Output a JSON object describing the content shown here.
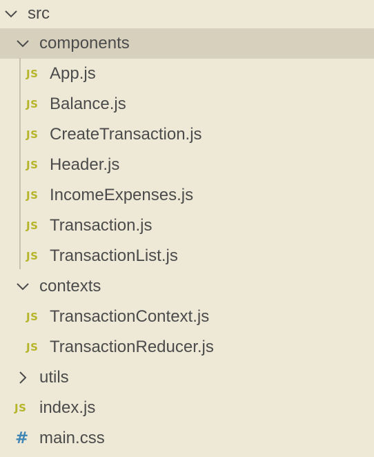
{
  "explorer": {
    "src": {
      "label": "src",
      "expanded": true,
      "chevron": "chevron-down-icon"
    },
    "components": {
      "label": "components",
      "expanded": true,
      "chevron": "chevron-down-icon",
      "files": [
        {
          "icon_text": "JS",
          "label": "App.js"
        },
        {
          "icon_text": "JS",
          "label": "Balance.js"
        },
        {
          "icon_text": "JS",
          "label": "CreateTransaction.js"
        },
        {
          "icon_text": "JS",
          "label": "Header.js"
        },
        {
          "icon_text": "JS",
          "label": "IncomeExpenses.js"
        },
        {
          "icon_text": "JS",
          "label": "Transaction.js"
        },
        {
          "icon_text": "JS",
          "label": "TransactionList.js"
        }
      ]
    },
    "contexts": {
      "label": "contexts",
      "expanded": true,
      "chevron": "chevron-down-icon",
      "files": [
        {
          "icon_text": "JS",
          "label": "TransactionContext.js"
        },
        {
          "icon_text": "JS",
          "label": "TransactionReducer.js"
        }
      ]
    },
    "utils": {
      "label": "utils",
      "expanded": false,
      "chevron": "chevron-right-icon"
    },
    "root_files": [
      {
        "icon_text": "JS",
        "icon": "js-file-icon",
        "label": "index.js"
      },
      {
        "icon_text": "#",
        "icon": "css-file-icon",
        "label": "main.css"
      }
    ]
  },
  "colors": {
    "background": "#eee8d6",
    "selected_row": "#d7d0bd",
    "js_icon": "#b5b52a",
    "css_icon": "#3f86b5",
    "text": "#4b4b4b"
  }
}
